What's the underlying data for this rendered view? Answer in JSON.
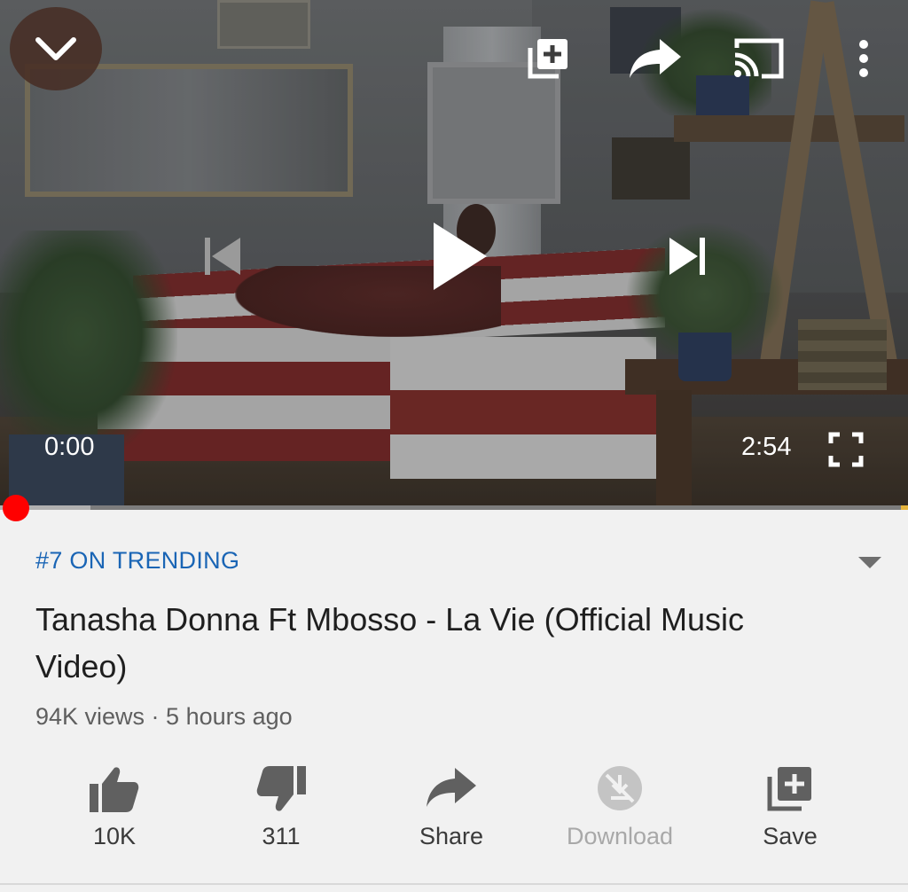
{
  "player": {
    "current_time": "0:00",
    "duration": "2:54",
    "progress_fraction": 0.0,
    "buffered_fraction": 0.1,
    "state": "paused",
    "icons": {
      "collapse": "chevron-down-icon",
      "add_to_playlist": "add-to-queue-icon",
      "share": "share-arrow-icon",
      "cast": "cast-icon",
      "more": "more-vert-icon",
      "previous": "skip-previous-icon",
      "play": "play-icon",
      "next": "skip-next-icon",
      "fullscreen": "fullscreen-icon"
    },
    "colors": {
      "scrubber": "#ff0000",
      "progress_track": "#7d7d7d"
    }
  },
  "video": {
    "trending_label": "#7 ON TRENDING",
    "title": "Tanasha Donna Ft Mbosso - La Vie (Official Music Video)",
    "meta": "94K views · 5 hours ago"
  },
  "actions": {
    "like": {
      "label": "10K",
      "icon": "thumb-up-icon"
    },
    "dislike": {
      "label": "311",
      "icon": "thumb-down-icon"
    },
    "share": {
      "label": "Share",
      "icon": "share-icon"
    },
    "download": {
      "label": "Download",
      "icon": "download-disabled-icon",
      "disabled": true
    },
    "save": {
      "label": "Save",
      "icon": "playlist-add-icon"
    }
  },
  "colors": {
    "accent_link": "#1a65b5",
    "text_primary": "#1f1f1f",
    "text_secondary": "#5f5f5f",
    "background": "#f1f1f1"
  }
}
